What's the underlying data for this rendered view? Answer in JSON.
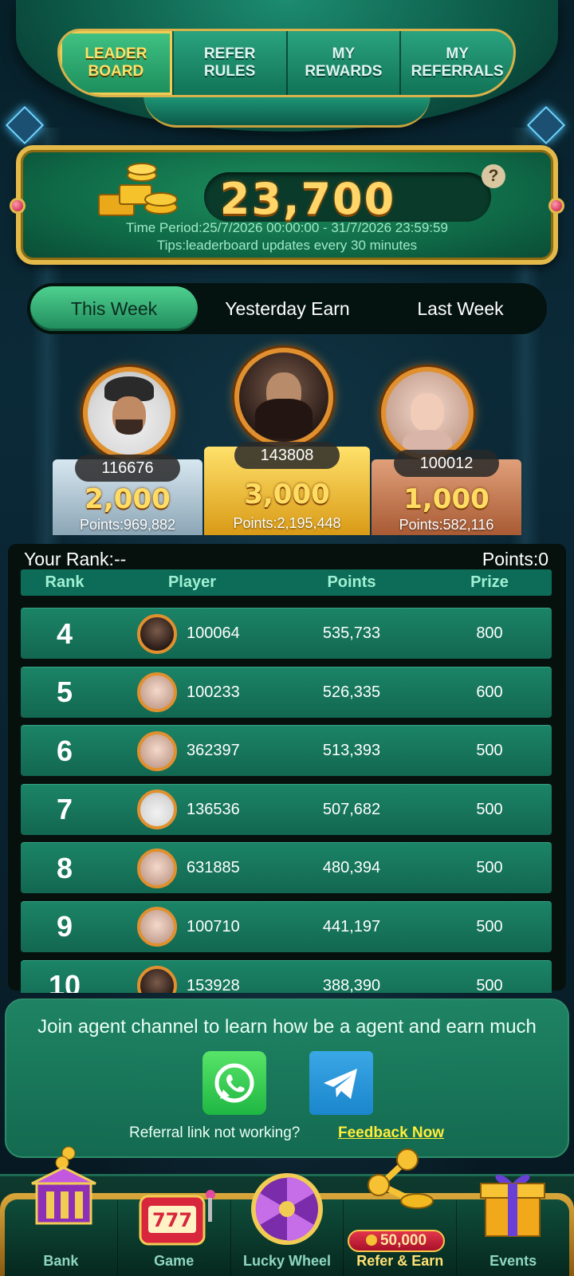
{
  "top_tabs": [
    {
      "label": "LEADER BOARD"
    },
    {
      "label": "REFER RULES"
    },
    {
      "label": "MY REWARDS"
    },
    {
      "label": "MY REFERRALS"
    }
  ],
  "prize_panel": {
    "amount": "23,700",
    "help": "?",
    "time_period": "Time Period:25/7/2026 00:00:00 - 31/7/2026 23:59:59",
    "tips": "Tips:leaderboard updates every 30 minutes"
  },
  "period_tabs": [
    {
      "label": "This Week"
    },
    {
      "label": "Yesterday Earn"
    },
    {
      "label": "Last Week"
    }
  ],
  "podium": {
    "first": {
      "id": "143808",
      "prize": "3,000",
      "points": "Points:2,195,448"
    },
    "second": {
      "id": "116676",
      "prize": "2,000",
      "points": "Points:969,882"
    },
    "third": {
      "id": "100012",
      "prize": "1,000",
      "points": "Points:582,116"
    }
  },
  "summary": {
    "your_rank": "Your Rank:--",
    "points": "Points:0"
  },
  "table": {
    "headers": [
      "Rank",
      "Player",
      "Points",
      "Prize"
    ],
    "rows": [
      {
        "rank": "4",
        "player": "100064",
        "points": "535,733",
        "prize": "800"
      },
      {
        "rank": "5",
        "player": "100233",
        "points": "526,335",
        "prize": "600"
      },
      {
        "rank": "6",
        "player": "362397",
        "points": "513,393",
        "prize": "500"
      },
      {
        "rank": "7",
        "player": "136536",
        "points": "507,682",
        "prize": "500"
      },
      {
        "rank": "8",
        "player": "631885",
        "points": "480,394",
        "prize": "500"
      },
      {
        "rank": "9",
        "player": "100710",
        "points": "441,197",
        "prize": "500"
      },
      {
        "rank": "10",
        "player": "153928",
        "points": "388,390",
        "prize": "500"
      }
    ]
  },
  "agent": {
    "title": "Join agent channel to learn how be a agent and earn much",
    "referral_text": "Referral link not working?",
    "feedback": "Feedback Now"
  },
  "bottom_nav": [
    {
      "label": "Bank"
    },
    {
      "label": "Game"
    },
    {
      "label": "Lucky Wheel"
    },
    {
      "label": "Refer & Earn"
    },
    {
      "label": "Events"
    }
  ],
  "refer_badge": "50,000",
  "colors": {
    "accent_green": "#1b8466",
    "gold": "#ffd667",
    "feedback_yellow": "#ffee3b"
  }
}
